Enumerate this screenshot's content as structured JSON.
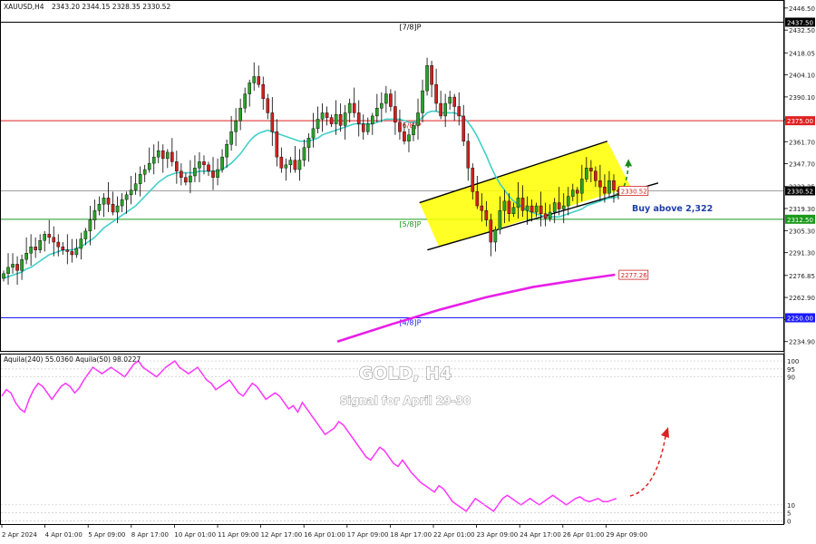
{
  "header": {
    "symbol": "XAUUSD,H4",
    "ohlc": "2343.20 2344.15 2328.35 2330.52",
    "indicator": "Aquila(240) 55.0360  Aquila(50) 98.0227"
  },
  "overlay": {
    "title": "GOLD, H4",
    "subtitle": "Signal for April 29-30",
    "buy_text": "Buy above 2,322"
  },
  "colors": {
    "bull": "#2aa12a",
    "bear": "#d02020",
    "ma_short": "#40d0c8",
    "ma_long": "#e81ee8",
    "oscillator": "#ff33ff",
    "channel_fill": "#ffff00",
    "arrow_up": "#1c8a1c",
    "arrow_osc": "#e02020",
    "murrey_top": "#000000",
    "murrey_resist": "#e02020",
    "murrey_support": "#1a9a1a",
    "murrey_base": "#1a1aff",
    "last_price": "#808080"
  },
  "chart_data": {
    "type": "candlestick",
    "price_axis": {
      "ylim": [
        2229.0,
        2451.0
      ],
      "ticks": [
        "2446.50",
        "2432.50",
        "2418.05",
        "2404.10",
        "2390.10",
        "2375.65",
        "2361.70",
        "2347.70",
        "2333.25",
        "2319.30",
        "2305.30",
        "2291.30",
        "2276.85",
        "2262.90",
        "2248.90",
        "2234.90"
      ]
    },
    "price_tags": [
      {
        "label": "2437.50",
        "value": 2437.5,
        "style": "black"
      },
      {
        "label": "2375.00",
        "value": 2375.0,
        "style": "red"
      },
      {
        "label": "2330.52",
        "value": 2330.52,
        "style": "black"
      },
      {
        "label": "2312.50",
        "value": 2312.5,
        "style": "green"
      },
      {
        "label": "2250.00",
        "value": 2250.0,
        "style": "blue"
      }
    ],
    "murrey_levels": [
      {
        "label": "[7/8]P",
        "value": 2437.5,
        "color": "murrey_top"
      },
      {
        "label": "[6/8]P",
        "value": 2375.0,
        "color": "murrey_resist"
      },
      {
        "label": "[5/8]P",
        "value": 2312.5,
        "color": "murrey_support"
      },
      {
        "label": "[4/8]P",
        "value": 2250.0,
        "color": "murrey_base"
      }
    ],
    "annotations": [
      {
        "label": "2330.52",
        "value": 2330.52,
        "color": "#d02020"
      },
      {
        "label": "2277.26",
        "value": 2277.26,
        "color": "#d02020"
      }
    ],
    "x_ticks": [
      "2 Apr 2024",
      "4 Apr 01:00",
      "5 Apr 09:00",
      "8 Apr 17:00",
      "10 Apr 01:00",
      "11 Apr 09:00",
      "12 Apr 17:00",
      "16 Apr 01:00",
      "17 Apr 09:00",
      "18 Apr 17:00",
      "22 Apr 01:00",
      "23 Apr 09:00",
      "24 Apr 17:00",
      "26 Apr 01:00",
      "29 Apr 09:00"
    ],
    "close_series": [
      2278,
      2282,
      2284,
      2280,
      2287,
      2291,
      2295,
      2293,
      2299,
      2303,
      2301,
      2298,
      2295,
      2293,
      2292,
      2290,
      2294,
      2300,
      2305,
      2312,
      2318,
      2322,
      2326,
      2322,
      2317,
      2321,
      2325,
      2328,
      2331,
      2335,
      2341,
      2344,
      2348,
      2352,
      2356,
      2351,
      2355,
      2349,
      2343,
      2339,
      2336,
      2340,
      2345,
      2349,
      2347,
      2343,
      2339,
      2344,
      2352,
      2360,
      2368,
      2375,
      2383,
      2392,
      2399,
      2403,
      2398,
      2389,
      2380,
      2368,
      2352,
      2345,
      2347,
      2350,
      2344,
      2350,
      2358,
      2364,
      2370,
      2376,
      2380,
      2377,
      2373,
      2379,
      2372,
      2380,
      2386,
      2380,
      2373,
      2368,
      2373,
      2378,
      2383,
      2386,
      2392,
      2384,
      2374,
      2368,
      2362,
      2366,
      2372,
      2380,
      2394,
      2410,
      2398,
      2386,
      2378,
      2386,
      2390,
      2384,
      2378,
      2362,
      2345,
      2330,
      2321,
      2318,
      2312,
      2298,
      2306,
      2318,
      2324,
      2316,
      2320,
      2326,
      2318,
      2321,
      2317,
      2321,
      2316,
      2313,
      2317,
      2323,
      2319,
      2321,
      2327,
      2331,
      2329,
      2338,
      2345,
      2343,
      2337,
      2333,
      2329,
      2337,
      2331,
      2330
    ],
    "ma_short": [
      2275,
      2276,
      2277,
      2278,
      2279,
      2281,
      2282,
      2284,
      2286,
      2288,
      2290,
      2291,
      2292,
      2293,
      2293,
      2293,
      2294,
      2295,
      2297,
      2299,
      2301,
      2304,
      2307,
      2309,
      2311,
      2313,
      2315,
      2317,
      2319,
      2321,
      2324,
      2327,
      2330,
      2333,
      2336,
      2338,
      2340,
      2341,
      2342,
      2342,
      2342,
      2342,
      2342,
      2343,
      2343,
      2343,
      2343,
      2343,
      2344,
      2346,
      2348,
      2351,
      2354,
      2358,
      2362,
      2365,
      2367,
      2368,
      2369,
      2368,
      2367,
      2366,
      2365,
      2364,
      2363,
      2362,
      2362,
      2362,
      2363,
      2364,
      2366,
      2367,
      2368,
      2369,
      2370,
      2371,
      2372,
      2373,
      2373,
      2373,
      2373,
      2373,
      2374,
      2375,
      2376,
      2376,
      2376,
      2376,
      2375,
      2374,
      2374,
      2375,
      2377,
      2380,
      2381,
      2381,
      2380,
      2380,
      2380,
      2380,
      2379,
      2377,
      2374,
      2370,
      2365,
      2359,
      2353,
      2346,
      2340,
      2335,
      2331,
      2327,
      2324,
      2322,
      2320,
      2318,
      2317,
      2316,
      2315,
      2314,
      2314,
      2314,
      2314,
      2315,
      2316,
      2317,
      2318,
      2319,
      2321,
      2322,
      2323,
      2324,
      2325,
      2326,
      2326,
      2327
    ],
    "ma_long": [
      {
        "x": 0.43,
        "y": 2234.9
      },
      {
        "x": 0.5,
        "y": 2246.0
      },
      {
        "x": 0.56,
        "y": 2255.0
      },
      {
        "x": 0.62,
        "y": 2263.0
      },
      {
        "x": 0.68,
        "y": 2269.5
      },
      {
        "x": 0.745,
        "y": 2274.5
      },
      {
        "x": 0.785,
        "y": 2277.3
      }
    ],
    "channel": {
      "lower_start": [
        0.56,
        2295.0
      ],
      "lower_end": [
        0.805,
        2333.0
      ],
      "upper_start": [
        0.535,
        2323.0
      ],
      "upper_end": [
        0.775,
        2362.0
      ]
    },
    "oscillator": {
      "name": "Aquila",
      "values": [
        55.03,
        98.02
      ],
      "levels": [
        10,
        5,
        0,
        90,
        95,
        100
      ],
      "ylim": [
        -2,
        104
      ],
      "series": [
        78,
        82,
        80,
        74,
        70,
        68,
        76,
        82,
        86,
        84,
        80,
        76,
        80,
        84,
        86,
        84,
        80,
        83,
        88,
        92,
        96,
        94,
        92,
        94,
        96,
        94,
        92,
        90,
        94,
        98,
        100,
        96,
        94,
        92,
        90,
        93,
        96,
        98,
        100,
        96,
        94,
        92,
        94,
        96,
        92,
        88,
        86,
        82,
        84,
        86,
        88,
        84,
        80,
        78,
        82,
        86,
        84,
        80,
        76,
        78,
        80,
        78,
        74,
        70,
        72,
        68,
        74,
        70,
        66,
        62,
        58,
        54,
        56,
        58,
        62,
        60,
        56,
        52,
        48,
        44,
        40,
        38,
        42,
        46,
        44,
        40,
        36,
        34,
        38,
        34,
        30,
        27,
        24,
        22,
        20,
        18,
        22,
        20,
        16,
        12,
        10,
        8,
        6,
        10,
        14,
        12,
        10,
        8,
        6,
        10,
        14,
        16,
        14,
        12,
        10,
        12,
        14,
        12,
        10,
        12,
        14,
        16,
        14,
        12,
        10,
        12,
        14,
        15,
        13,
        12,
        13,
        14,
        12,
        12,
        13,
        14
      ]
    }
  }
}
